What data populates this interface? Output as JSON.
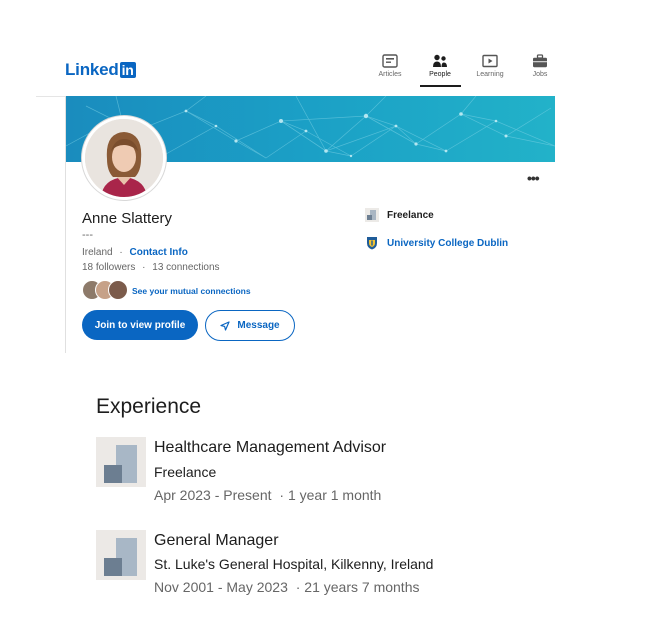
{
  "nav": {
    "logo_text": "Linked",
    "logo_box": "in",
    "items": [
      {
        "label": "Articles",
        "icon": "articles-icon"
      },
      {
        "label": "People",
        "icon": "people-icon"
      },
      {
        "label": "Learning",
        "icon": "learning-icon"
      },
      {
        "label": "Jobs",
        "icon": "jobs-icon"
      }
    ],
    "active": "People"
  },
  "profile": {
    "name": "Anne Slattery",
    "headline": "---",
    "location": "Ireland",
    "separator": "·",
    "contact_link": "Contact Info",
    "followers": "18 followers",
    "connections": "13 connections",
    "mutual_link": "See your mutual connections",
    "join_button": "Join to view profile",
    "message_button": "Message",
    "current_company": "Freelance",
    "education": "University College Dublin"
  },
  "experience": {
    "title": "Experience",
    "items": [
      {
        "role": "Healthcare Management Advisor",
        "company": "Freelance",
        "dates": "Apr 2023 - Present",
        "duration": "· 1 year 1 month"
      },
      {
        "role": "General Manager",
        "company": "St. Luke's General Hospital, Kilkenny, Ireland",
        "dates": "Nov 2001 - May 2023",
        "duration": "· 21 years 7 months"
      }
    ]
  },
  "colors": {
    "brand": "#0a66c2",
    "banner_start": "#1a90c0",
    "banner_end": "#1fb0c8"
  }
}
